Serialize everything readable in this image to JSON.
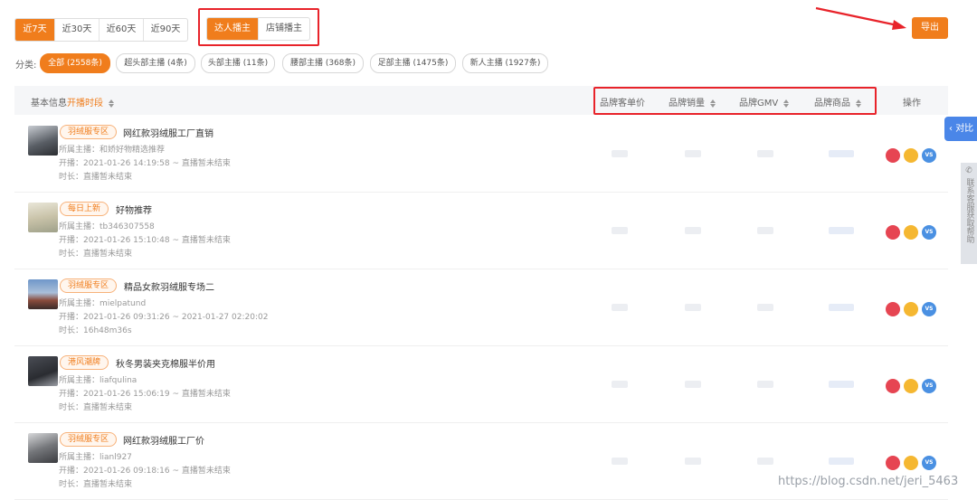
{
  "time_tabs": [
    "近7天",
    "近30天",
    "近60天",
    "近90天"
  ],
  "anchor_tabs": [
    "达人播主",
    "店铺播主"
  ],
  "export_label": "导出",
  "category_label": "分类:",
  "categories": [
    "全部 (2558条)",
    "超头部主播 (4条)",
    "头部主播 (11条)",
    "腰部主播 (368条)",
    "足部主播 (1475条)",
    "新人主播 (1927条)"
  ],
  "table_header": {
    "basic_info": "基本信息",
    "start_time": "开播时段",
    "brand_unit_price": "品牌客单价",
    "brand_sales": "品牌销量",
    "brand_gmv": "品牌GMV",
    "brand_goods": "品牌商品",
    "action": "操作"
  },
  "rows": [
    {
      "tag": "羽绒服专区",
      "title": "网红款羽绒服工厂直销",
      "anchor": "所属主播：和娇好物精选推荐",
      "time": "开播：2021-01-26 14:19:58 ~ 直播暂未结束",
      "duration": "时长：直播暂未结束"
    },
    {
      "tag": "每日上新",
      "title": "好物推荐",
      "anchor": "所属主播：tb346307558",
      "time": "开播：2021-01-26 15:10:48 ~ 直播暂未结束",
      "duration": "时长：直播暂未结束"
    },
    {
      "tag": "羽绒服专区",
      "title": "精品女款羽绒服专场二",
      "anchor": "所属主播：mielpatund",
      "time": "开播：2021-01-26 09:31:26 ~ 2021-01-27 02:20:02",
      "duration": "时长：16h48m36s"
    },
    {
      "tag": "港风潮牌",
      "title": "秋冬男装夹克棉服半价用",
      "anchor": "所属主播：liafqulina",
      "time": "开播：2021-01-26 15:06:19 ~ 直播暂未结束",
      "duration": "时长：直播暂未结束"
    },
    {
      "tag": "羽绒服专区",
      "title": "网红款羽绒服工厂价",
      "anchor": "所属主播：lianl927",
      "time": "开播：2021-01-26 09:18:16 ~ 直播暂未结束",
      "duration": "时长：直播暂未结束"
    }
  ],
  "action_icons": [
    "star-icon",
    "more-icon",
    "vs-icon"
  ],
  "vs_label": "VS",
  "side_compare": "对比",
  "side_help": "联系客服获取帮助",
  "watermark": "https://blog.csdn.net/jeri_5463",
  "colors": {
    "accent": "#f07d1c",
    "highlight_box": "#e8232a",
    "side_tab": "#4a86e8"
  }
}
